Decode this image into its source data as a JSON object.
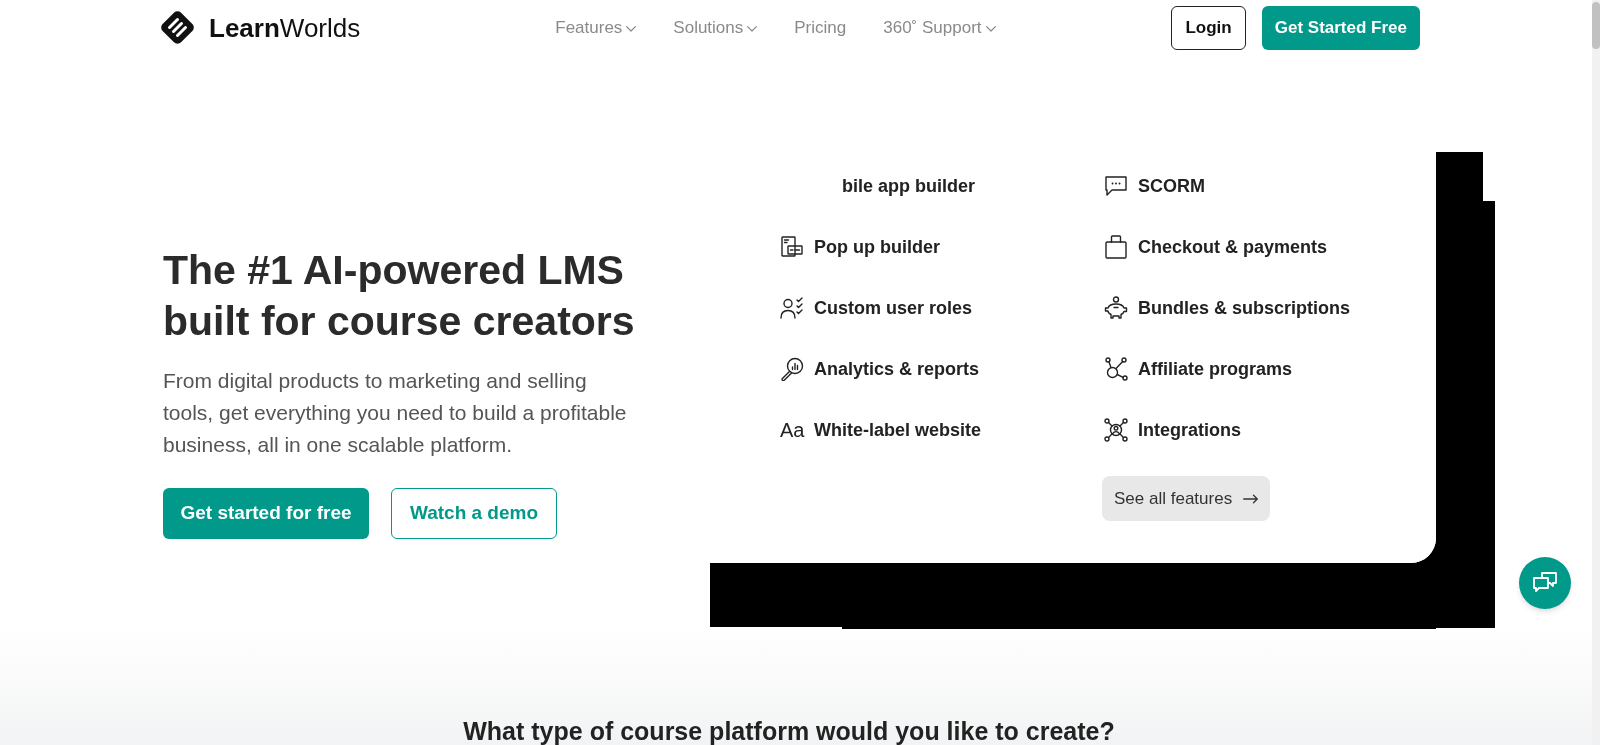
{
  "header": {
    "logo": "**Learn**Worlds",
    "nav": [
      {
        "label": "Features",
        "dropdown": true
      },
      {
        "label": "Solutions",
        "dropdown": true
      },
      {
        "label": "Pricing",
        "dropdown": false
      },
      {
        "label": "360˚ Support",
        "dropdown": true
      }
    ],
    "buttons": [
      {
        "label": "Login",
        "kind": "outline"
      },
      {
        "label": "Get Started Free",
        "kind": "primary"
      }
    ]
  },
  "hero": {
    "title": "The #1 AI-powered LMS built for course creators",
    "text": "From digital products to marketing and selling tools, get everything you need to build a profitable business, all in one scalable platform.",
    "buttons": [
      {
        "label": "Get started for free",
        "kind": "primary"
      },
      {
        "label": "Watch a demo",
        "kind": "outline"
      }
    ]
  },
  "features": {
    "columns": [
      [
        {
          "label": "bile app builder",
          "kind": "partial"
        },
        {
          "label": "Pop up builder",
          "kind": "full"
        },
        {
          "label": "Custom user roles",
          "kind": "full"
        },
        {
          "label": "Analytics & reports",
          "kind": "full"
        },
        {
          "label": "White-label website",
          "kind": "full",
          "glyph": "Aa"
        }
      ],
      [
        {
          "label": "SCORM",
          "kind": "full"
        },
        {
          "label": "Checkout & payments",
          "kind": "full"
        },
        {
          "label": "Bundles & subscriptions",
          "kind": "full"
        },
        {
          "label": "Affiliate programs",
          "kind": "full"
        },
        {
          "label": "Integrations",
          "kind": "full"
        }
      ]
    ],
    "see_all": "See all features"
  },
  "section": {
    "title": "What type of course platform would you like to create?"
  }
}
